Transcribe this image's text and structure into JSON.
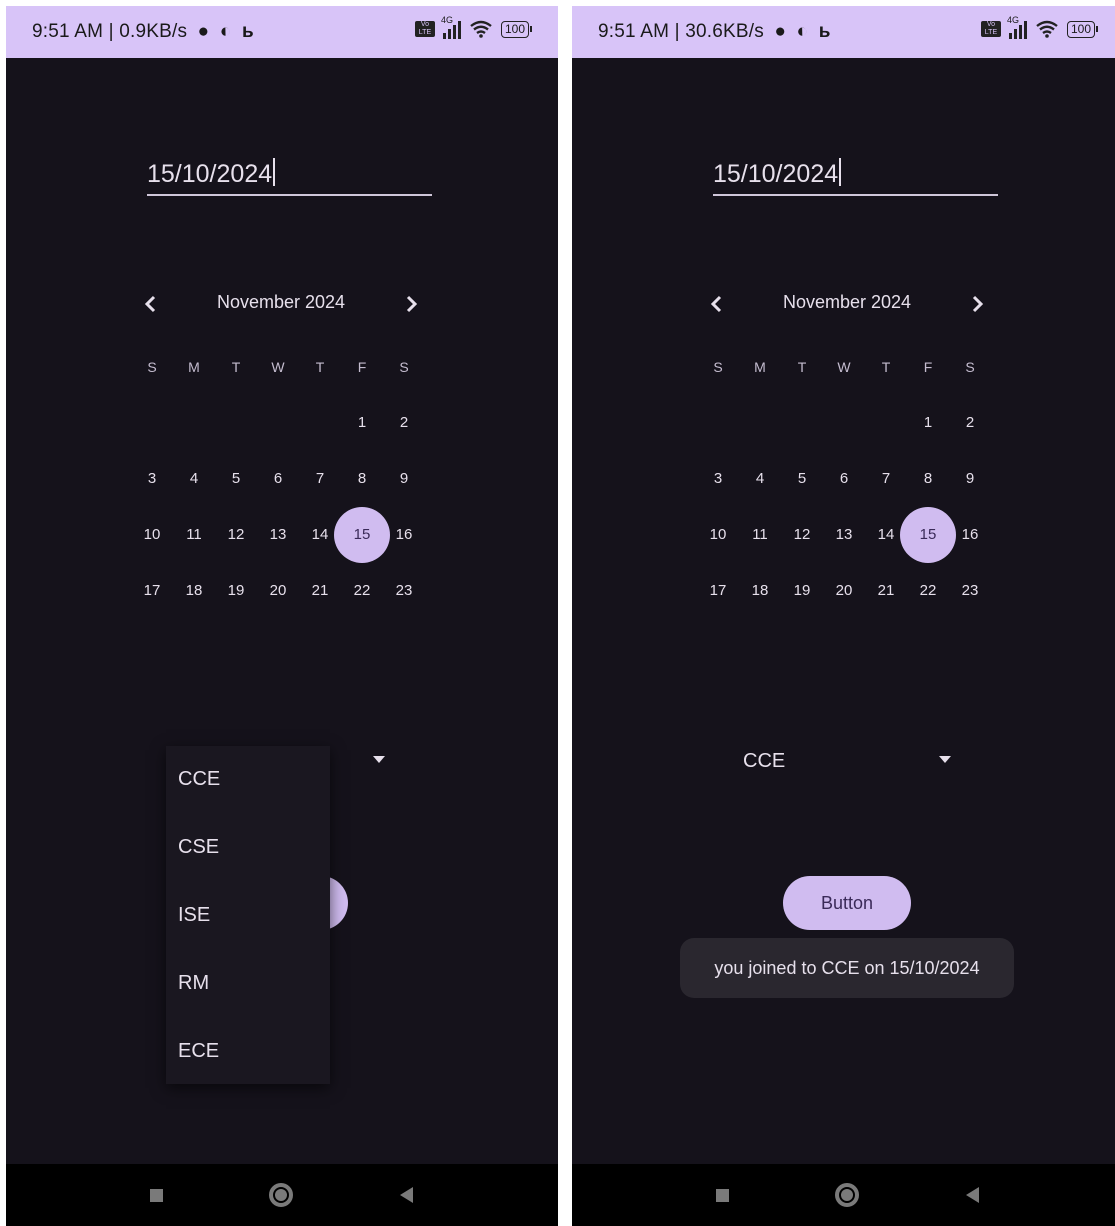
{
  "screens": [
    {
      "status_bar": {
        "time": "9:51 AM",
        "speed": "0.9KB/s",
        "network_label": "4G",
        "volte_label": "Vo LTE",
        "battery_level": "100"
      },
      "date_field": {
        "value": "15/10/2024"
      },
      "calendar": {
        "month_title": "November 2024",
        "weekdays": [
          "S",
          "M",
          "T",
          "W",
          "T",
          "F",
          "S"
        ],
        "weeks": [
          [
            "",
            "",
            "",
            "",
            "",
            "1",
            "2"
          ],
          [
            "3",
            "4",
            "5",
            "6",
            "7",
            "8",
            "9"
          ],
          [
            "10",
            "11",
            "12",
            "13",
            "14",
            "15",
            "16"
          ],
          [
            "17",
            "18",
            "19",
            "20",
            "21",
            "22",
            "23"
          ]
        ],
        "selected_day": "15"
      },
      "spinner": {
        "selected": "CCE",
        "expanded": true
      },
      "dropdown": {
        "options": [
          "CCE",
          "CSE",
          "ISE",
          "RM",
          "ECE"
        ]
      },
      "button": {
        "label": "Button",
        "visible": false
      },
      "toast": null
    },
    {
      "status_bar": {
        "time": "9:51 AM",
        "speed": "30.6KB/s",
        "network_label": "4G",
        "volte_label": "Vo LTE",
        "battery_level": "100"
      },
      "date_field": {
        "value": "15/10/2024"
      },
      "calendar": {
        "month_title": "November 2024",
        "weekdays": [
          "S",
          "M",
          "T",
          "W",
          "T",
          "F",
          "S"
        ],
        "weeks": [
          [
            "",
            "",
            "",
            "",
            "",
            "1",
            "2"
          ],
          [
            "3",
            "4",
            "5",
            "6",
            "7",
            "8",
            "9"
          ],
          [
            "10",
            "11",
            "12",
            "13",
            "14",
            "15",
            "16"
          ],
          [
            "17",
            "18",
            "19",
            "20",
            "21",
            "22",
            "23"
          ]
        ],
        "selected_day": "15"
      },
      "spinner": {
        "selected": "CCE",
        "expanded": false
      },
      "dropdown": {
        "options": []
      },
      "button": {
        "label": "Button",
        "visible": true
      },
      "toast": {
        "text": "you joined to CCE on 15/10/2024"
      }
    }
  ],
  "colors": {
    "background": "#15121b",
    "status_bar": "#d8c4f8",
    "accent": "#d0bcf0",
    "text": "#e7e0ec",
    "toast_background": "#2a272f",
    "nav_bar": "#000000"
  },
  "icons": {
    "status_bar": [
      "chat-bubble-icon",
      "data-saver-icon",
      "b-app-icon",
      "volte-icon",
      "signal-icon",
      "wifi-icon",
      "battery-icon"
    ],
    "calendar": [
      "chevron-left-icon",
      "chevron-right-icon"
    ],
    "spinner": [
      "dropdown-arrow-icon"
    ],
    "nav_bar": [
      "recents-icon",
      "home-icon",
      "back-icon"
    ]
  }
}
